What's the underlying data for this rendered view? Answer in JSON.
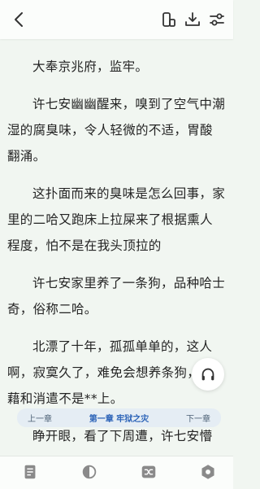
{
  "header": {
    "back_icon": "back-arrow-icon",
    "actions": [
      "font-size-icon",
      "download-icon",
      "settings-sliders-icon"
    ]
  },
  "reader": {
    "paragraphs": [
      "大奉京兆府，监牢。",
      "许七安幽幽醒来，嗅到了空气中潮湿的腐臭味，令人轻微的不适，胃酸翻涌。",
      "这扑面而来的臭味是怎么回事，家里的二哈又跑床上拉屎来了根据熏人程度，怕不是在我头顶拉的",
      "许七安家里养了一条狗，品种哈士奇，俗称二哈。",
      "北漂了十年，孤孤单单的，这人啊，寂寞久了，难免会想养条狗，慰藉和消遣不是**上。",
      "睁开眼，看了下周遭，许七安懵"
    ]
  },
  "chapter_nav": {
    "prev_label": "上一章",
    "current_label": "第一章 牢狱之灾",
    "next_label": "下一章"
  },
  "audio_button": {
    "icon": "headphones-icon"
  },
  "bottom_toolbar": {
    "icons": [
      "catalog-icon",
      "night-mode-icon",
      "page-turn-icon",
      "settings-icon"
    ]
  }
}
